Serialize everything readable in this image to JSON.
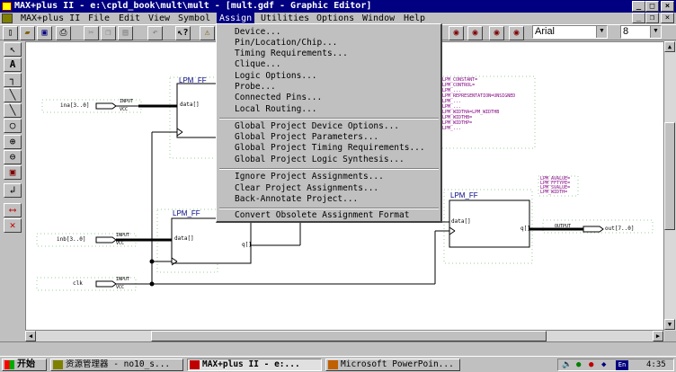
{
  "window": {
    "title": "MAX+plus II - e:\\cpld_book\\mult\\mult - [mult.gdf - Graphic Editor]"
  },
  "menubar": {
    "items": [
      "MAX+plus II",
      "File",
      "Edit",
      "View",
      "Symbol",
      "Assign",
      "Utilities",
      "Options",
      "Window",
      "Help"
    ],
    "active": "Assign"
  },
  "toolbar": {
    "font_name": "Arial",
    "font_size": "8"
  },
  "assign_menu": {
    "group1": [
      "Device...",
      "Pin/Location/Chip...",
      "Timing Requirements...",
      "Clique...",
      "Logic Options...",
      "Probe...",
      "Connected Pins...",
      "Local Routing..."
    ],
    "group2": [
      "Global Project Device Options...",
      "Global Project Parameters...",
      "Global Project Timing Requirements...",
      "Global Project Logic Synthesis..."
    ],
    "group3": [
      "Ignore Project Assignments...",
      "Clear Project Assignments...",
      "Back-Annotate Project..."
    ],
    "group4": [
      "Convert Obsolete Assignment Format"
    ]
  },
  "schematic": {
    "ff_title": "LPM_FF",
    "ff_left_upper_title": "LPM_FF",
    "ff_left_lower_title": "LPM_FF",
    "ff_right_title": "LPM_FF",
    "ff_data_pin": "data[]",
    "ff_q_pin": "q[]",
    "input_a": "ina[3..0]",
    "input_b": "inb[3..0]",
    "input_clk": "clk",
    "output": "out[7..0]",
    "pin_input": "INPUT",
    "pin_vcc": "VCC",
    "pin_output": "OUTPUT",
    "param_block_1": [
      "LPM_CONSTANT=",
      "LPM_CONTROL=",
      "LPM_...",
      "LPM_REPRESENTATION=UNSIGNED",
      "LPM_...",
      "LPM_...",
      "LPM_WIDTHA=LPM_WIDTHB",
      "LPM_WIDTHB=",
      "LPM_WIDTHP=",
      "LPM_..."
    ],
    "param_block_2": [
      "LPM_AVALUE=",
      "LPM_FFTYPE=",
      "LPM_SVALUE=",
      "LPM_WIDTH="
    ]
  },
  "taskbar": {
    "start": "开始",
    "tasks": [
      "资源管理器 - no10_s...",
      "MAX+plus II - e:...",
      "Microsoft PowerPoin..."
    ],
    "clock": "4:35"
  },
  "colors": {
    "titlebar": "#000080",
    "wire": "#000000",
    "param_text": "#800080",
    "symbol_line": "#000000"
  }
}
